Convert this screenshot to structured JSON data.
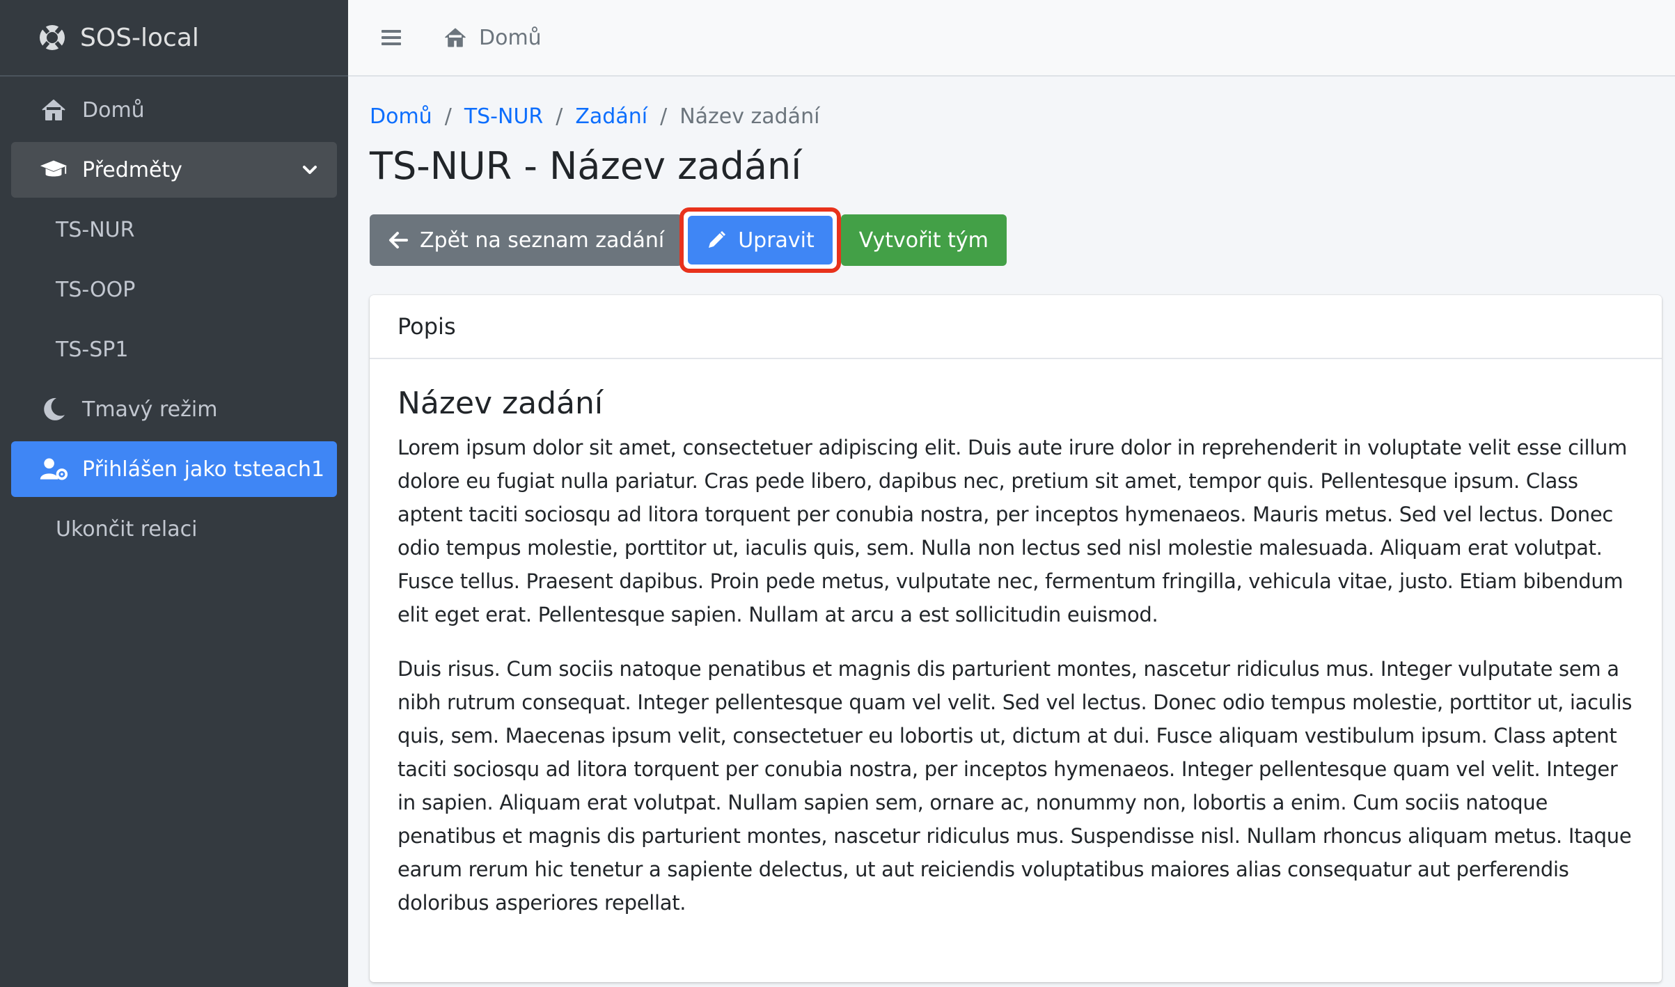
{
  "brand": {
    "name": "SOS-local"
  },
  "sidebar": {
    "items": [
      {
        "label": "Domů",
        "icon": "home-icon"
      },
      {
        "label": "Předměty",
        "icon": "graduation-cap-icon"
      },
      {
        "label": "TS-NUR"
      },
      {
        "label": "TS-OOP"
      },
      {
        "label": "TS-SP1"
      },
      {
        "label": "Tmavý režim",
        "icon": "moon-icon"
      },
      {
        "label": "Přihlášen jako tsteach1",
        "icon": "user-gear-icon"
      },
      {
        "label": "Ukončit relaci"
      }
    ]
  },
  "topbar": {
    "home_label": "Domů"
  },
  "breadcrumb": {
    "items": [
      "Domů",
      "TS-NUR",
      "Zadání",
      "Název zadání"
    ],
    "separator": "/"
  },
  "page": {
    "title": "TS-NUR - Název zadání"
  },
  "buttons": {
    "back": "Zpět na seznam zadání",
    "edit": "Upravit",
    "create_team": "Vytvořit tým"
  },
  "card": {
    "header": "Popis",
    "heading": "Název zadání",
    "paragraphs": [
      "Lorem ipsum dolor sit amet, consectetuer adipiscing elit. Duis aute irure dolor in reprehenderit in voluptate velit esse cillum dolore eu fugiat nulla pariatur. Cras pede libero, dapibus nec, pretium sit amet, tempor quis. Pellentesque ipsum. Class aptent taciti sociosqu ad litora torquent per conubia nostra, per inceptos hymenaeos. Mauris metus. Sed vel lectus. Donec odio tempus molestie, porttitor ut, iaculis quis, sem. Nulla non lectus sed nisl molestie malesuada. Aliquam erat volutpat. Fusce tellus. Praesent dapibus. Proin pede metus, vulputate nec, fermentum fringilla, vehicula vitae, justo. Etiam bibendum elit eget erat. Pellentesque sapien. Nullam at arcu a est sollicitudin euismod.",
      "Duis risus. Cum sociis natoque penatibus et magnis dis parturient montes, nascetur ridiculus mus. Integer vulputate sem a nibh rutrum consequat. Integer pellentesque quam vel velit. Sed vel lectus. Donec odio tempus molestie, porttitor ut, iaculis quis, sem. Maecenas ipsum velit, consectetuer eu lobortis ut, dictum at dui. Fusce aliquam vestibulum ipsum. Class aptent taciti sociosqu ad litora torquent per conubia nostra, per inceptos hymenaeos. Integer pellentesque quam vel velit. Integer in sapien. Aliquam erat volutpat. Nullam sapien sem, ornare ac, nonummy non, lobortis a enim. Cum sociis natoque penatibus et magnis dis parturient montes, nascetur ridiculus mus. Suspendisse nisl. Nullam rhoncus aliquam metus. Itaque earum rerum hic tenetur a sapiente delectus, ut aut reiciendis voluptatibus maiores alias consequatur aut perferendis doloribus asperiores repellat."
    ]
  },
  "colors": {
    "sidebar_bg": "#343a40",
    "primary": "#3f86f5",
    "secondary": "#6c757d",
    "success": "#43a047",
    "highlight": "#e8321c"
  }
}
